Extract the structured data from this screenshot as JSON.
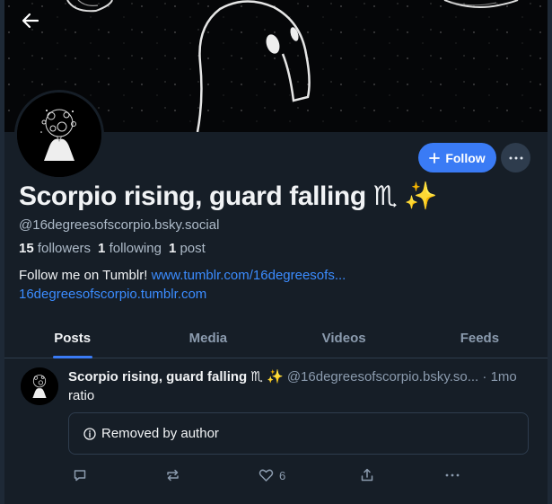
{
  "profile": {
    "display_name": "Scorpio rising, guard falling ♏ ✨",
    "handle": "@16degreesofscorpio.bsky.social",
    "followers_count": "15",
    "followers_label": "followers",
    "following_count": "1",
    "following_label": "following",
    "posts_count": "1",
    "posts_label": "post",
    "bio_text": "Follow me on Tumblr!",
    "bio_link1": "www.tumblr.com/16degreesofs...",
    "bio_link2": "16degreesofscorpio.tumblr.com"
  },
  "actions": {
    "follow_label": "Follow"
  },
  "tabs": [
    {
      "label": "Posts",
      "active": true
    },
    {
      "label": "Media",
      "active": false
    },
    {
      "label": "Videos",
      "active": false
    },
    {
      "label": "Feeds",
      "active": false
    }
  ],
  "post": {
    "author_name": "Scorpio rising, guard falling ♏ ✨",
    "author_handle": "@16degreesofscorpio.bsky.so...",
    "time": "· 1mo",
    "text": "ratio",
    "removed_label": "Removed by author",
    "like_count": "6"
  },
  "icons": [
    "back-arrow-icon",
    "plus-icon",
    "ellipsis-icon",
    "info-icon",
    "reply-icon",
    "repost-icon",
    "heart-icon",
    "share-icon"
  ],
  "colors": {
    "accent": "#3a7bf5",
    "link": "#3b8cff",
    "background": "#161e27"
  }
}
